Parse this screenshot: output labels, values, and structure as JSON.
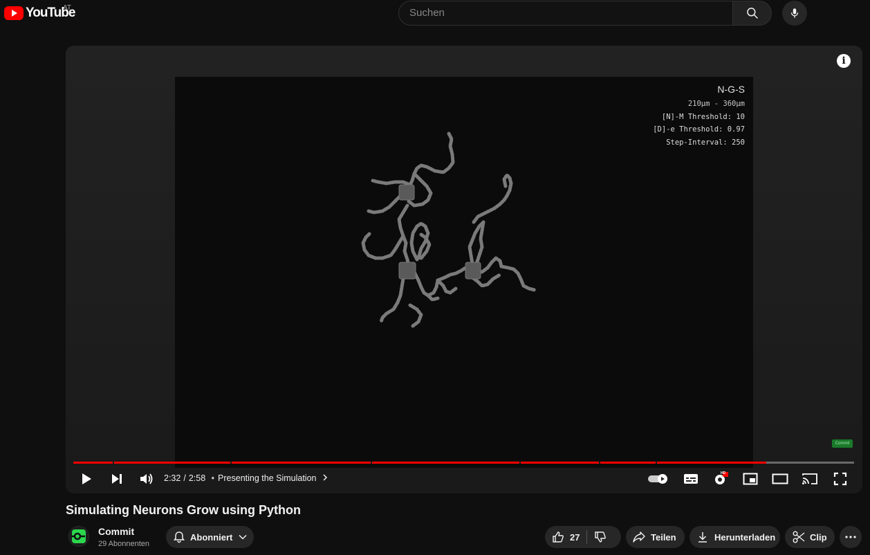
{
  "header": {
    "logo_text": "YouTube",
    "country_code": "AT",
    "search_placeholder": "Suchen"
  },
  "video": {
    "overlay": {
      "title": "N-G-S",
      "range": "210µm - 360µm",
      "n_threshold": "[N]-M Threshold: 10",
      "d_threshold": "[D]-e Threshold: 0.97",
      "step_interval": "Step-Interval: 250"
    },
    "watermark": "Commit",
    "progress": 0.8876,
    "current_time": "2:32",
    "total_time": "2:58",
    "time_separator": "/",
    "chapter": "Presenting the Simulation",
    "hd_badge": "HD"
  },
  "title": "Simulating Neurons Grow using Python",
  "channel": {
    "name": "Commit",
    "subscribers": "29 Abonnenten",
    "subscribe_label": "Abonniert"
  },
  "actions": {
    "likes": "27",
    "share": "Teilen",
    "download": "Herunterladen",
    "clip": "Clip"
  },
  "colors": {
    "accent": "#ff0000",
    "background": "#0f0f0f",
    "pill": "#272727"
  }
}
